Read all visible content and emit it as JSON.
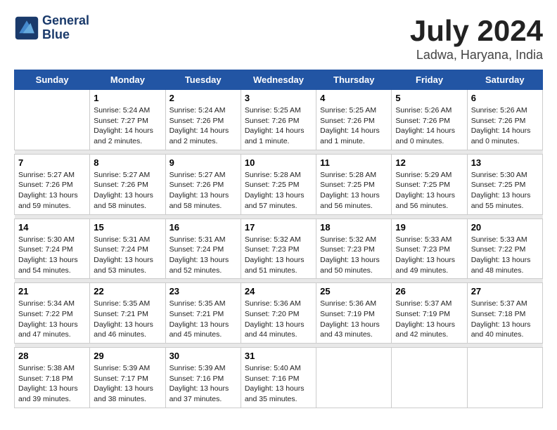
{
  "header": {
    "logo_line1": "General",
    "logo_line2": "Blue",
    "title": "July 2024",
    "subtitle": "Ladwa, Haryana, India"
  },
  "days_of_week": [
    "Sunday",
    "Monday",
    "Tuesday",
    "Wednesday",
    "Thursday",
    "Friday",
    "Saturday"
  ],
  "weeks": [
    {
      "days": [
        {
          "date": "",
          "info": ""
        },
        {
          "date": "1",
          "info": "Sunrise: 5:24 AM\nSunset: 7:27 PM\nDaylight: 14 hours\nand 2 minutes."
        },
        {
          "date": "2",
          "info": "Sunrise: 5:24 AM\nSunset: 7:26 PM\nDaylight: 14 hours\nand 2 minutes."
        },
        {
          "date": "3",
          "info": "Sunrise: 5:25 AM\nSunset: 7:26 PM\nDaylight: 14 hours\nand 1 minute."
        },
        {
          "date": "4",
          "info": "Sunrise: 5:25 AM\nSunset: 7:26 PM\nDaylight: 14 hours\nand 1 minute."
        },
        {
          "date": "5",
          "info": "Sunrise: 5:26 AM\nSunset: 7:26 PM\nDaylight: 14 hours\nand 0 minutes."
        },
        {
          "date": "6",
          "info": "Sunrise: 5:26 AM\nSunset: 7:26 PM\nDaylight: 14 hours\nand 0 minutes."
        }
      ]
    },
    {
      "days": [
        {
          "date": "7",
          "info": "Sunrise: 5:27 AM\nSunset: 7:26 PM\nDaylight: 13 hours\nand 59 minutes."
        },
        {
          "date": "8",
          "info": "Sunrise: 5:27 AM\nSunset: 7:26 PM\nDaylight: 13 hours\nand 58 minutes."
        },
        {
          "date": "9",
          "info": "Sunrise: 5:27 AM\nSunset: 7:26 PM\nDaylight: 13 hours\nand 58 minutes."
        },
        {
          "date": "10",
          "info": "Sunrise: 5:28 AM\nSunset: 7:25 PM\nDaylight: 13 hours\nand 57 minutes."
        },
        {
          "date": "11",
          "info": "Sunrise: 5:28 AM\nSunset: 7:25 PM\nDaylight: 13 hours\nand 56 minutes."
        },
        {
          "date": "12",
          "info": "Sunrise: 5:29 AM\nSunset: 7:25 PM\nDaylight: 13 hours\nand 56 minutes."
        },
        {
          "date": "13",
          "info": "Sunrise: 5:30 AM\nSunset: 7:25 PM\nDaylight: 13 hours\nand 55 minutes."
        }
      ]
    },
    {
      "days": [
        {
          "date": "14",
          "info": "Sunrise: 5:30 AM\nSunset: 7:24 PM\nDaylight: 13 hours\nand 54 minutes."
        },
        {
          "date": "15",
          "info": "Sunrise: 5:31 AM\nSunset: 7:24 PM\nDaylight: 13 hours\nand 53 minutes."
        },
        {
          "date": "16",
          "info": "Sunrise: 5:31 AM\nSunset: 7:24 PM\nDaylight: 13 hours\nand 52 minutes."
        },
        {
          "date": "17",
          "info": "Sunrise: 5:32 AM\nSunset: 7:23 PM\nDaylight: 13 hours\nand 51 minutes."
        },
        {
          "date": "18",
          "info": "Sunrise: 5:32 AM\nSunset: 7:23 PM\nDaylight: 13 hours\nand 50 minutes."
        },
        {
          "date": "19",
          "info": "Sunrise: 5:33 AM\nSunset: 7:23 PM\nDaylight: 13 hours\nand 49 minutes."
        },
        {
          "date": "20",
          "info": "Sunrise: 5:33 AM\nSunset: 7:22 PM\nDaylight: 13 hours\nand 48 minutes."
        }
      ]
    },
    {
      "days": [
        {
          "date": "21",
          "info": "Sunrise: 5:34 AM\nSunset: 7:22 PM\nDaylight: 13 hours\nand 47 minutes."
        },
        {
          "date": "22",
          "info": "Sunrise: 5:35 AM\nSunset: 7:21 PM\nDaylight: 13 hours\nand 46 minutes."
        },
        {
          "date": "23",
          "info": "Sunrise: 5:35 AM\nSunset: 7:21 PM\nDaylight: 13 hours\nand 45 minutes."
        },
        {
          "date": "24",
          "info": "Sunrise: 5:36 AM\nSunset: 7:20 PM\nDaylight: 13 hours\nand 44 minutes."
        },
        {
          "date": "25",
          "info": "Sunrise: 5:36 AM\nSunset: 7:19 PM\nDaylight: 13 hours\nand 43 minutes."
        },
        {
          "date": "26",
          "info": "Sunrise: 5:37 AM\nSunset: 7:19 PM\nDaylight: 13 hours\nand 42 minutes."
        },
        {
          "date": "27",
          "info": "Sunrise: 5:37 AM\nSunset: 7:18 PM\nDaylight: 13 hours\nand 40 minutes."
        }
      ]
    },
    {
      "days": [
        {
          "date": "28",
          "info": "Sunrise: 5:38 AM\nSunset: 7:18 PM\nDaylight: 13 hours\nand 39 minutes."
        },
        {
          "date": "29",
          "info": "Sunrise: 5:39 AM\nSunset: 7:17 PM\nDaylight: 13 hours\nand 38 minutes."
        },
        {
          "date": "30",
          "info": "Sunrise: 5:39 AM\nSunset: 7:16 PM\nDaylight: 13 hours\nand 37 minutes."
        },
        {
          "date": "31",
          "info": "Sunrise: 5:40 AM\nSunset: 7:16 PM\nDaylight: 13 hours\nand 35 minutes."
        },
        {
          "date": "",
          "info": ""
        },
        {
          "date": "",
          "info": ""
        },
        {
          "date": "",
          "info": ""
        }
      ]
    }
  ]
}
